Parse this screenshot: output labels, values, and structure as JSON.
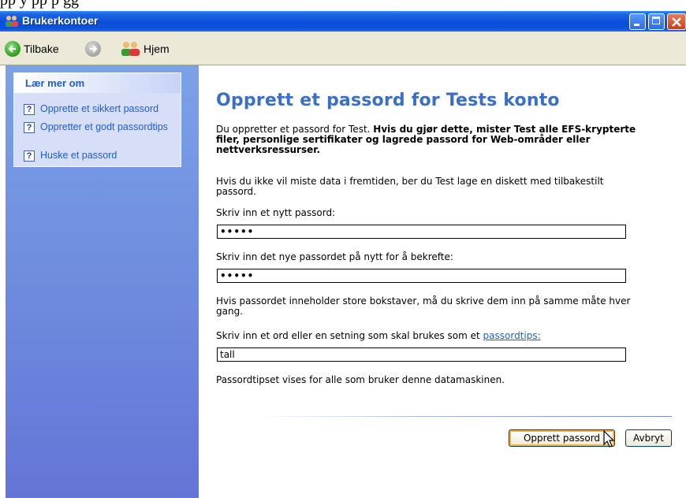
{
  "top_strip_text": "pp      y           pp   p      gg",
  "window": {
    "title": "Brukerkontoer"
  },
  "nav": {
    "back_label": "Tilbake",
    "home_label": "Hjem"
  },
  "sidebar": {
    "header": "Lær mer om",
    "items": [
      {
        "label": "Opprette et sikkert passord"
      },
      {
        "label": "Oppretter et godt passordtips"
      },
      {
        "label": "Huske et passord"
      }
    ]
  },
  "main": {
    "heading": "Opprett et passord for Tests konto",
    "intro_normal": "Du oppretter et passord for Test. ",
    "intro_bold": "Hvis du gjør dette, mister Test alle EFS-krypterte filer, personlige sertifikater og lagrede passord for Web-områder eller nettverksressurser.",
    "backup_text": "Hvis du ikke vil miste data i fremtiden, ber du Test lage en diskett med tilbakestilt passord.",
    "new_password_label": "Skriv inn et nytt passord:",
    "new_password_value": "•••••",
    "confirm_label": "Skriv inn det nye passordet på nytt for å bekrefte:",
    "confirm_value": "•••••",
    "case_note": "Hvis passordet inneholder store bokstaver, må du skrive dem inn på samme måte hver gang.",
    "hint_label_prefix": "Skriv inn et ord eller en setning som skal brukes som et ",
    "hint_link": "passordtips:",
    "hint_value": "tall",
    "hint_note": "Passordtipset vises for alle som bruker denne datamaskinen.",
    "create_button": "Opprett passord",
    "cancel_button": "Avbryt"
  },
  "colors": {
    "titlebar": "#0a4fd8",
    "sidebar": "#6f8fdf",
    "heading": "#3a6fc8",
    "link": "#215dc6"
  }
}
